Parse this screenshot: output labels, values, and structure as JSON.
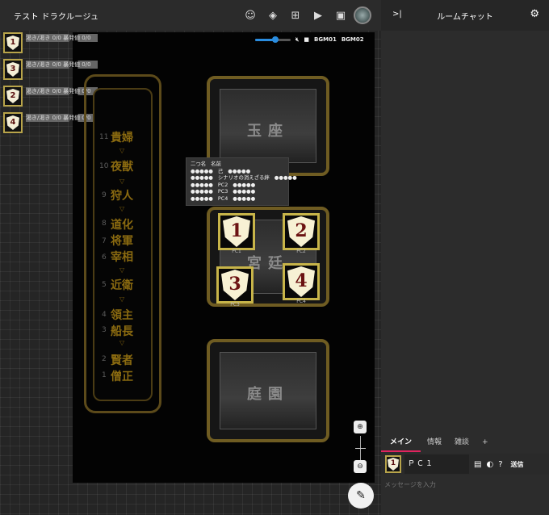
{
  "header": {
    "room_title": "テスト ドラクルージュ",
    "icons": [
      "face-icon",
      "layers-icon",
      "add-box-icon",
      "video-icon",
      "movie-icon",
      "avatar"
    ]
  },
  "bgm": {
    "volume": 0.5,
    "track1": "BGM01",
    "track2": "BGM02"
  },
  "characters": [
    {
      "num": "1",
      "status": "渇き/渇き 0/0 暴発値 0/0"
    },
    {
      "num": "3",
      "status": "渇き/渇き 0/0 暴発値 0/0"
    },
    {
      "num": "2",
      "status": "渇き/渇き 0/0 暴発値 0/0"
    },
    {
      "num": "4",
      "status": "渇き/渇き 0/0 暴発値 0/0"
    }
  ],
  "tower": {
    "ranks": [
      "貴婦",
      "夜獣",
      "狩人",
      "道化",
      "将軍",
      "宰相",
      "近衛",
      "領主",
      "船長",
      "賢者",
      "僧正"
    ],
    "levels": [
      "11",
      "10",
      "9",
      "8",
      "7",
      "6",
      "5",
      "4",
      "3",
      "2",
      "1"
    ]
  },
  "locations": {
    "top": "玉座",
    "middle": "宮廷",
    "bottom": "庭園"
  },
  "pcs": [
    {
      "num": "1",
      "name": "PC1"
    },
    {
      "num": "2",
      "name": "PC2"
    },
    {
      "num": "3",
      "name": "PC3"
    },
    {
      "num": "4",
      "name": "PC4"
    }
  ],
  "tooltip": {
    "header": [
      "二つ名",
      "名前"
    ],
    "rows": [
      [
        "●●●●●",
        "己",
        "●●●●●"
      ],
      [
        "●●●●●",
        "シナリオの消えざる絆",
        "●●●●●"
      ],
      [
        "●●●●●",
        "PC2",
        "●●●●●"
      ],
      [
        "●●●●●",
        "PC3",
        "●●●●●"
      ],
      [
        "●●●●●",
        "PC4",
        "●●●●●"
      ]
    ]
  },
  "chat": {
    "title": "ルームチャット",
    "tabs": [
      "メイン",
      "情報",
      "雑談",
      "+"
    ],
    "sender_icon_num": "1",
    "sender_name": "ＰＣ１",
    "send_label": "送信",
    "input_placeholder": "メッセージを入力"
  }
}
